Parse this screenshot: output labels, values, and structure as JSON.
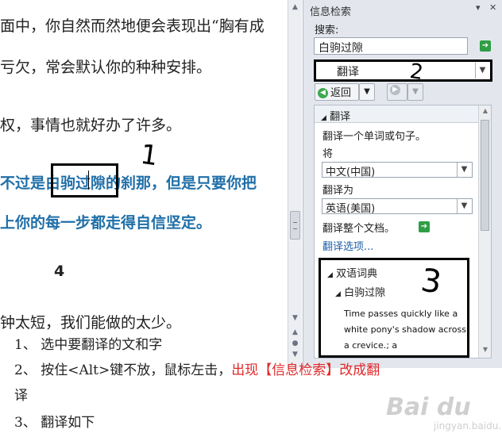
{
  "document": {
    "line1": "面中，你自然而然地便会表现出“胸有成",
    "line2": "亏欠，常会默认你的种种安排。",
    "line3": "权，事情也就好办了许多。",
    "line4_pre": "不过是",
    "selected_text": "白驹过隙",
    "line4_post": "的刹那，但是只要你把",
    "line5": "上你的每一步都走得自信坚定。",
    "section_number": "4",
    "line6": "钟太短，我们能做的太少。",
    "annotation_1": "1"
  },
  "research_pane": {
    "title": "信息检索",
    "search_label": "搜索:",
    "search_value": "白驹过隙",
    "service_value": "翻译",
    "annotation_2": "2",
    "back_label": "返回",
    "section_title": "翻译",
    "translate_word_hint": "翻译一个单词或句子。",
    "from_label": "将",
    "from_value": "中文(中国)",
    "to_label": "翻译为",
    "to_value": "英语(美国)",
    "translate_doc": "翻译整个文档。",
    "translate_options": "翻译选项...",
    "dict_title": "双语词典",
    "dict_term": "白驹过隙",
    "dict_definition": "Time passes quickly like a white pony's shadow across a crevice.; a",
    "annotation_3": "3"
  },
  "instructions": {
    "step1": "1、 选中要翻译的文和字",
    "step2_black": "2、 按住<Alt>键不放，鼠标左击，",
    "step2_red": "出现【信息检索】改成翻",
    "step2_red_cont": "译",
    "step3": "3、 翻译如下"
  },
  "watermark": {
    "text": "Bai du",
    "sub": "jingyan.baidu.com"
  },
  "colors": {
    "highlight_blue": "#1f6fa8",
    "red_text": "#e0282a",
    "pane_bg": "#e3e7ed"
  }
}
